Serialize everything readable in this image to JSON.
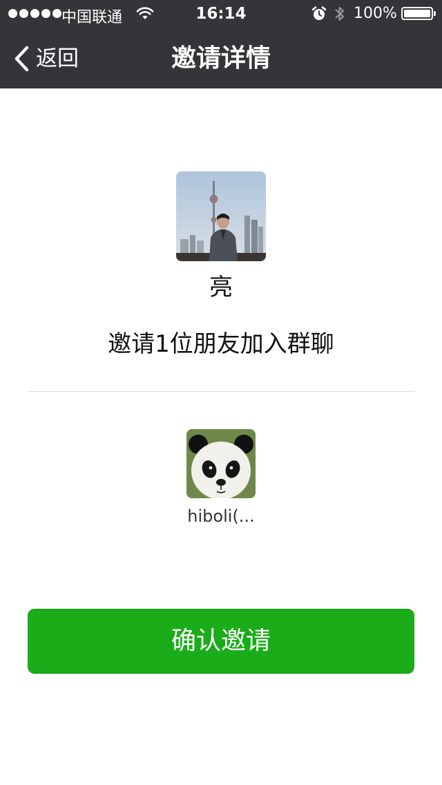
{
  "status_bar": {
    "carrier": "中国联通",
    "time": "16:14",
    "battery_percent": "100%",
    "icons": [
      "signal-dots-icon",
      "wifi-icon",
      "alarm-icon",
      "bluetooth-icon",
      "battery-icon"
    ]
  },
  "nav": {
    "back_label": "返回",
    "title": "邀请详情",
    "back_icon": "chevron-left-icon"
  },
  "inviter": {
    "name": "亮"
  },
  "invite": {
    "summary": "邀请1位朋友加入群聊"
  },
  "invitees": [
    {
      "name": "hiboli(..."
    }
  ],
  "actions": {
    "confirm_label": "确认邀请"
  },
  "colors": {
    "nav_background": "#353539",
    "primary_button": "#1aad19",
    "page_background": "#ffffff"
  }
}
